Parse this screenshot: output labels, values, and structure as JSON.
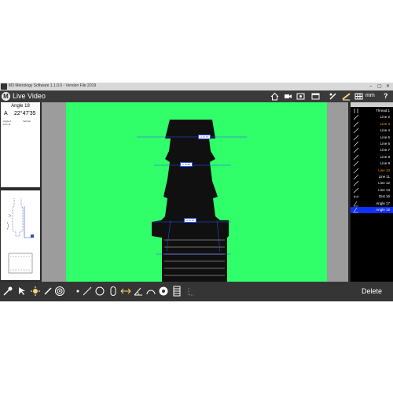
{
  "titlebar": {
    "title": "M3 Metrology Software 1.1.0.0 - Version File 2019",
    "min": "–",
    "max": "▢",
    "close": "✕"
  },
  "toolbar": {
    "logo": "M",
    "mode": "Live Video",
    "unit": "mm",
    "help": "?"
  },
  "readout": {
    "title": "Angle 18",
    "letter": "A",
    "value": "22°47'35",
    "sub1": "Angle 2",
    "sub2": "Line 11",
    "sub3": "Vertical"
  },
  "features": [
    {
      "label": "Thread 1",
      "icon": "thread-icon",
      "color": "#ffffff"
    },
    {
      "label": "Line 2",
      "icon": "line-icon",
      "color": "#ffffff"
    },
    {
      "label": "Line 3",
      "icon": "line-icon",
      "color": "#ff9900"
    },
    {
      "label": "Line 4",
      "icon": "line-icon",
      "color": "#ffffff"
    },
    {
      "label": "Line 5",
      "icon": "line-icon",
      "color": "#ffffff"
    },
    {
      "label": "Line 6",
      "icon": "line-icon",
      "color": "#ffffff"
    },
    {
      "label": "Line 7",
      "icon": "line-icon",
      "color": "#ffffff"
    },
    {
      "label": "Line 8",
      "icon": "line-icon",
      "color": "#ffffff"
    },
    {
      "label": "Line 9",
      "icon": "line-icon",
      "color": "#ffffff"
    },
    {
      "label": "Line 10",
      "icon": "line-icon",
      "color": "#ff9900"
    },
    {
      "label": "Line 11",
      "icon": "line-icon",
      "color": "#ffffff"
    },
    {
      "label": "Line 12",
      "icon": "line-icon",
      "color": "#ffffff"
    },
    {
      "label": "Line 13",
      "icon": "line-icon",
      "color": "#ffffff"
    },
    {
      "label": "Dist 16",
      "icon": "distance-icon",
      "color": "#ffffff"
    },
    {
      "label": "Angle 17",
      "icon": "angle-icon",
      "color": "#ffffff"
    },
    {
      "label": "Angle 18",
      "icon": "angle-icon",
      "color": "#ffffff",
      "selected": true
    }
  ],
  "bottombar": {
    "delete_label": "Delete"
  },
  "colors": {
    "video_bg": "#30ff6a",
    "selected": "#1030ff",
    "highlight": "#ff9900"
  }
}
